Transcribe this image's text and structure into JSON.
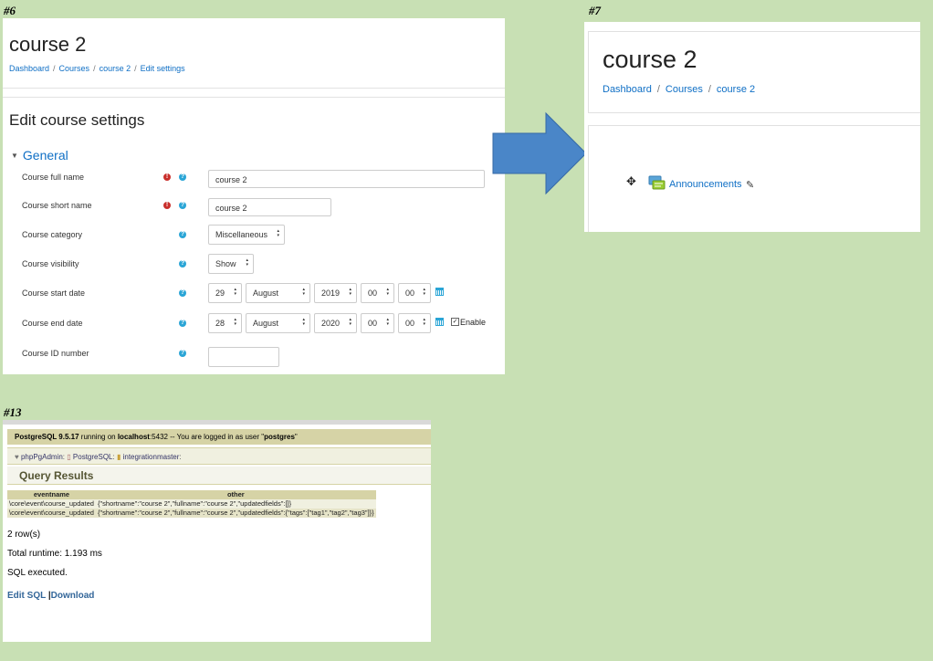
{
  "tags": {
    "p6": "#6",
    "p7": "#7",
    "p13": "#13"
  },
  "colors": {
    "background": "#c8e0b4",
    "link": "#0f6fc5",
    "arrow": "#4a86c8",
    "required": "#c9302c",
    "help": "#2aa5d6",
    "pg_bar": "#d6d3a6"
  },
  "panel6": {
    "course_title": "course 2",
    "breadcrumb": [
      "Dashboard",
      "Courses",
      "course 2",
      "Edit settings"
    ],
    "separator": "/",
    "page_heading": "Edit course settings",
    "section": "General",
    "fields": {
      "full_name": {
        "label": "Course full name",
        "value": "course 2"
      },
      "short_name": {
        "label": "Course short name",
        "value": "course 2"
      },
      "category": {
        "label": "Course category",
        "value": "Miscellaneous"
      },
      "visibility": {
        "label": "Course visibility",
        "value": "Show"
      },
      "start_date": {
        "label": "Course start date",
        "day": "29",
        "month": "August",
        "year": "2019",
        "hour": "00",
        "minute": "00"
      },
      "end_date": {
        "label": "Course end date",
        "day": "28",
        "month": "August",
        "year": "2020",
        "hour": "00",
        "minute": "00",
        "enable_label": "Enable",
        "enabled": true
      },
      "id_number": {
        "label": "Course ID number",
        "value": ""
      }
    },
    "icons": {
      "required": "exclamation-circle-icon",
      "help": "question-circle-icon",
      "calendar": "calendar-icon"
    }
  },
  "panel7": {
    "course_title": "course 2",
    "breadcrumb": [
      "Dashboard",
      "Courses",
      "course 2"
    ],
    "separator": "/",
    "activity": "Announcements",
    "icons": {
      "move": "move-icon",
      "forum": "forum-icon",
      "edit": "pencil-icon"
    }
  },
  "panel13": {
    "info": {
      "server": "PostgreSQL 9.5.17",
      "running_on": " running on ",
      "host": "localhost",
      "port_text": ":5432 -- You are logged in as user \"",
      "user": "postgres",
      "end": "\""
    },
    "nav": [
      "phpPgAdmin",
      "PostgreSQL",
      "integrationmaster"
    ],
    "query_results_title": "Query Results",
    "table": {
      "columns": [
        "eventname",
        "other"
      ],
      "rows": [
        [
          "\\core\\event\\course_updated",
          "{\"shortname\":\"course 2\",\"fullname\":\"course 2\",\"updatedfields\":[]}"
        ],
        [
          "\\core\\event\\course_updated",
          "{\"shortname\":\"course 2\",\"fullname\":\"course 2\",\"updatedfields\":{\"tags\":[\"tag1\",\"tag2\",\"tag3\"]}}"
        ]
      ]
    },
    "row_count": "2 row(s)",
    "runtime": "Total runtime: 1.193 ms",
    "status": "SQL executed.",
    "actions": {
      "edit": "Edit SQL",
      "separator": "|",
      "download": "Download"
    }
  }
}
